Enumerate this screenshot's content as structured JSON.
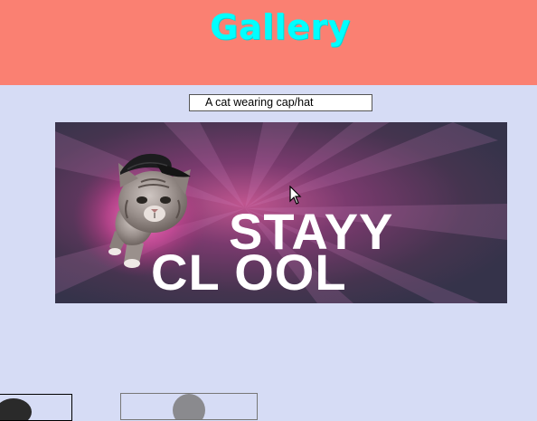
{
  "header": {
    "title": "Gallery",
    "background": "#fa8072",
    "title_color": "#00ffff"
  },
  "image_caption": {
    "value": "A cat wearing cap/hat"
  },
  "main_image": {
    "banner_line1": "STAYY",
    "banner_line2": "CL OOL",
    "subject": "cat-wearing-cap"
  },
  "page": {
    "background": "#d6dcf5"
  }
}
